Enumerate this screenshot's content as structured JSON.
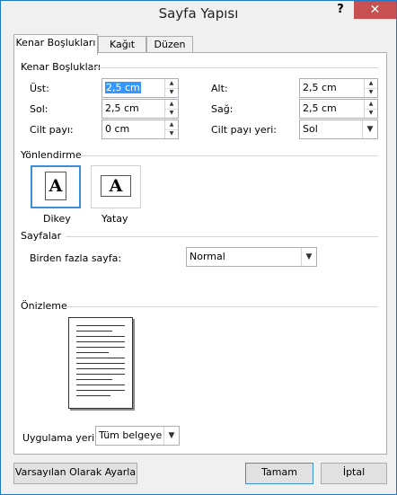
{
  "window": {
    "title": "Sayfa Yapısı",
    "help": "?",
    "close": "✕"
  },
  "tabs": [
    {
      "label": "Kenar Boşlukları"
    },
    {
      "label": "Kağıt"
    },
    {
      "label": "Düzen"
    }
  ],
  "margins": {
    "title": "Kenar Boşlukları",
    "ust_label": "Üst:",
    "ust_value": "2,5 cm",
    "alt_label": "Alt:",
    "alt_value": "2,5 cm",
    "sol_label": "Sol:",
    "sol_value": "2,5 cm",
    "sag_label": "Sağ:",
    "sag_value": "2,5 cm",
    "cilt_payi_label": "Cilt payı:",
    "cilt_payi_value": "0 cm",
    "cilt_payi_yeri_label": "Cilt payı yeri:",
    "cilt_payi_yeri_value": "Sol"
  },
  "orientation": {
    "title": "Yönlendirme",
    "portrait_label": "Dikey",
    "landscape_label": "Yatay",
    "glyph": "A"
  },
  "pages": {
    "title": "Sayfalar",
    "multiple_label": "Birden fazla sayfa:",
    "multiple_value": "Normal"
  },
  "preview": {
    "title": "Önizleme"
  },
  "apply": {
    "label": "Uygulama yeri:",
    "value": "Tüm belgeye"
  },
  "buttons": {
    "default": "Varsayılan Olarak Ayarla",
    "ok": "Tamam",
    "cancel": "İptal"
  },
  "colors": {
    "accent": "#3c8fd8",
    "close_bg": "#c75050",
    "selection": "#3399ff"
  }
}
